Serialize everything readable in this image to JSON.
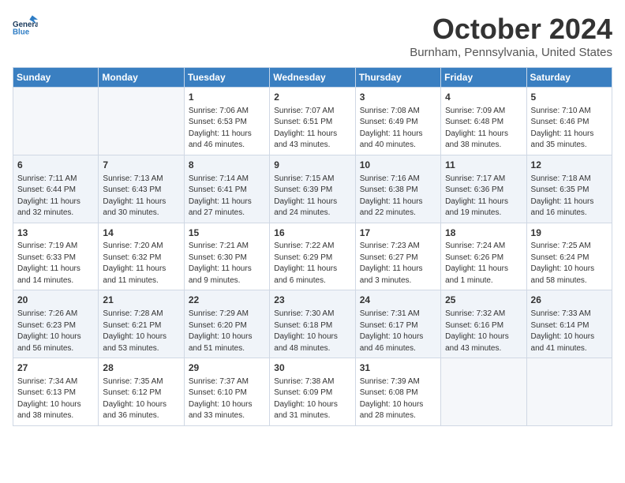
{
  "header": {
    "logo_line1": "General",
    "logo_line2": "Blue",
    "month": "October 2024",
    "location": "Burnham, Pennsylvania, United States"
  },
  "weekdays": [
    "Sunday",
    "Monday",
    "Tuesday",
    "Wednesday",
    "Thursday",
    "Friday",
    "Saturday"
  ],
  "weeks": [
    [
      {
        "day": "",
        "info": ""
      },
      {
        "day": "",
        "info": ""
      },
      {
        "day": "1",
        "info": "Sunrise: 7:06 AM\nSunset: 6:53 PM\nDaylight: 11 hours and 46 minutes."
      },
      {
        "day": "2",
        "info": "Sunrise: 7:07 AM\nSunset: 6:51 PM\nDaylight: 11 hours and 43 minutes."
      },
      {
        "day": "3",
        "info": "Sunrise: 7:08 AM\nSunset: 6:49 PM\nDaylight: 11 hours and 40 minutes."
      },
      {
        "day": "4",
        "info": "Sunrise: 7:09 AM\nSunset: 6:48 PM\nDaylight: 11 hours and 38 minutes."
      },
      {
        "day": "5",
        "info": "Sunrise: 7:10 AM\nSunset: 6:46 PM\nDaylight: 11 hours and 35 minutes."
      }
    ],
    [
      {
        "day": "6",
        "info": "Sunrise: 7:11 AM\nSunset: 6:44 PM\nDaylight: 11 hours and 32 minutes."
      },
      {
        "day": "7",
        "info": "Sunrise: 7:13 AM\nSunset: 6:43 PM\nDaylight: 11 hours and 30 minutes."
      },
      {
        "day": "8",
        "info": "Sunrise: 7:14 AM\nSunset: 6:41 PM\nDaylight: 11 hours and 27 minutes."
      },
      {
        "day": "9",
        "info": "Sunrise: 7:15 AM\nSunset: 6:39 PM\nDaylight: 11 hours and 24 minutes."
      },
      {
        "day": "10",
        "info": "Sunrise: 7:16 AM\nSunset: 6:38 PM\nDaylight: 11 hours and 22 minutes."
      },
      {
        "day": "11",
        "info": "Sunrise: 7:17 AM\nSunset: 6:36 PM\nDaylight: 11 hours and 19 minutes."
      },
      {
        "day": "12",
        "info": "Sunrise: 7:18 AM\nSunset: 6:35 PM\nDaylight: 11 hours and 16 minutes."
      }
    ],
    [
      {
        "day": "13",
        "info": "Sunrise: 7:19 AM\nSunset: 6:33 PM\nDaylight: 11 hours and 14 minutes."
      },
      {
        "day": "14",
        "info": "Sunrise: 7:20 AM\nSunset: 6:32 PM\nDaylight: 11 hours and 11 minutes."
      },
      {
        "day": "15",
        "info": "Sunrise: 7:21 AM\nSunset: 6:30 PM\nDaylight: 11 hours and 9 minutes."
      },
      {
        "day": "16",
        "info": "Sunrise: 7:22 AM\nSunset: 6:29 PM\nDaylight: 11 hours and 6 minutes."
      },
      {
        "day": "17",
        "info": "Sunrise: 7:23 AM\nSunset: 6:27 PM\nDaylight: 11 hours and 3 minutes."
      },
      {
        "day": "18",
        "info": "Sunrise: 7:24 AM\nSunset: 6:26 PM\nDaylight: 11 hours and 1 minute."
      },
      {
        "day": "19",
        "info": "Sunrise: 7:25 AM\nSunset: 6:24 PM\nDaylight: 10 hours and 58 minutes."
      }
    ],
    [
      {
        "day": "20",
        "info": "Sunrise: 7:26 AM\nSunset: 6:23 PM\nDaylight: 10 hours and 56 minutes."
      },
      {
        "day": "21",
        "info": "Sunrise: 7:28 AM\nSunset: 6:21 PM\nDaylight: 10 hours and 53 minutes."
      },
      {
        "day": "22",
        "info": "Sunrise: 7:29 AM\nSunset: 6:20 PM\nDaylight: 10 hours and 51 minutes."
      },
      {
        "day": "23",
        "info": "Sunrise: 7:30 AM\nSunset: 6:18 PM\nDaylight: 10 hours and 48 minutes."
      },
      {
        "day": "24",
        "info": "Sunrise: 7:31 AM\nSunset: 6:17 PM\nDaylight: 10 hours and 46 minutes."
      },
      {
        "day": "25",
        "info": "Sunrise: 7:32 AM\nSunset: 6:16 PM\nDaylight: 10 hours and 43 minutes."
      },
      {
        "day": "26",
        "info": "Sunrise: 7:33 AM\nSunset: 6:14 PM\nDaylight: 10 hours and 41 minutes."
      }
    ],
    [
      {
        "day": "27",
        "info": "Sunrise: 7:34 AM\nSunset: 6:13 PM\nDaylight: 10 hours and 38 minutes."
      },
      {
        "day": "28",
        "info": "Sunrise: 7:35 AM\nSunset: 6:12 PM\nDaylight: 10 hours and 36 minutes."
      },
      {
        "day": "29",
        "info": "Sunrise: 7:37 AM\nSunset: 6:10 PM\nDaylight: 10 hours and 33 minutes."
      },
      {
        "day": "30",
        "info": "Sunrise: 7:38 AM\nSunset: 6:09 PM\nDaylight: 10 hours and 31 minutes."
      },
      {
        "day": "31",
        "info": "Sunrise: 7:39 AM\nSunset: 6:08 PM\nDaylight: 10 hours and 28 minutes."
      },
      {
        "day": "",
        "info": ""
      },
      {
        "day": "",
        "info": ""
      }
    ]
  ]
}
